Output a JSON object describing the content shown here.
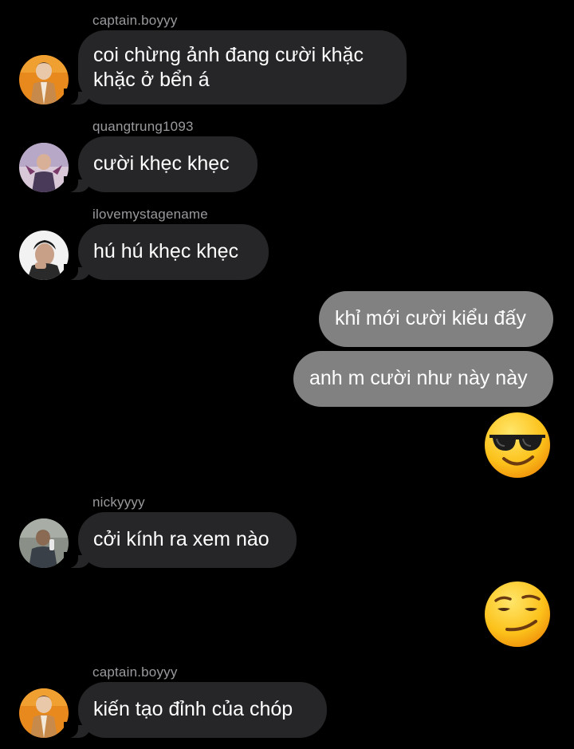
{
  "messages": [
    {
      "sender": "captain.boyyy",
      "lines": [
        "coi chừng ảnh đang cười khặc",
        "khặc ở bển á"
      ]
    },
    {
      "sender": "quangtrung1093",
      "text": "cười khẹc khẹc"
    },
    {
      "sender": "ilovemystagename",
      "text": "hú hú khẹc khẹc"
    },
    {
      "text": "khỉ mới cười kiểu đấy"
    },
    {
      "text": "anh m cười như này này"
    },
    {
      "emoji": "smiling-face-with-sunglasses"
    },
    {
      "sender": "nickyyyy",
      "text": "cởi kính ra xem nào"
    },
    {
      "emoji": "smirking-face"
    },
    {
      "sender": "captain.boyyy",
      "text": "kiến tạo đỉnh của chóp"
    }
  ],
  "colors": {
    "background": "#000000",
    "incoming_bubble": "#262628",
    "outgoing_bubble": "#818181",
    "sender_name": "#9a9a9e",
    "message_text": "#ffffff"
  }
}
